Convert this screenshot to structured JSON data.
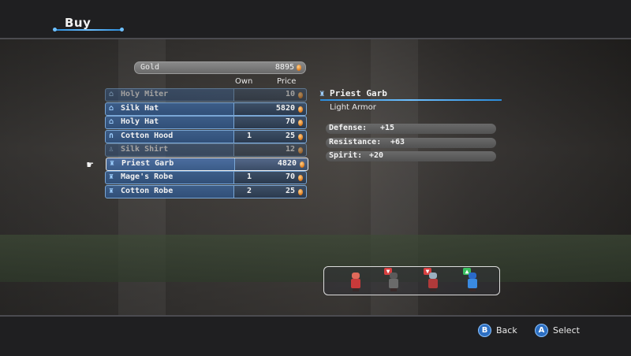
{
  "header": {
    "title": "Buy"
  },
  "gold": {
    "label": "Gold",
    "value": "8895"
  },
  "columns": {
    "own": "Own",
    "price": "Price"
  },
  "items": [
    {
      "name": "Holy Miter",
      "icon": "hat-icon",
      "own": "",
      "price": "10",
      "available": false
    },
    {
      "name": "Silk Hat",
      "icon": "hat-icon",
      "own": "",
      "price": "5820",
      "available": true
    },
    {
      "name": "Holy Hat",
      "icon": "hat-icon",
      "own": "",
      "price": "70",
      "available": true
    },
    {
      "name": "Cotton Hood",
      "icon": "hood-icon",
      "own": "1",
      "price": "25",
      "available": true
    },
    {
      "name": "Silk Shirt",
      "icon": "shirt-icon",
      "own": "",
      "price": "12",
      "available": false
    },
    {
      "name": "Priest Garb",
      "icon": "robe-icon",
      "own": "",
      "price": "4820",
      "available": true,
      "selected": true
    },
    {
      "name": "Mage's Robe",
      "icon": "robe-icon",
      "own": "1",
      "price": "70",
      "available": true
    },
    {
      "name": "Cotton Robe",
      "icon": "robe-icon",
      "own": "2",
      "price": "25",
      "available": true
    }
  ],
  "detail": {
    "title": "Priest Garb",
    "icon": "robe-icon",
    "subtitle": "Light Armor",
    "stats": [
      {
        "label": "Defense:",
        "value": "+15"
      },
      {
        "label": "Resistance:",
        "value": "+63"
      },
      {
        "label": "Spirit:",
        "value": "+20"
      }
    ]
  },
  "party": [
    {
      "name": "red-fighter",
      "head": "#e06a5a",
      "body": "#c83a3a",
      "badge": ""
    },
    {
      "name": "witch",
      "head": "#5a5a5a",
      "body": "#6a6a6a",
      "badge": "down",
      "badgeColor": "#d84040"
    },
    {
      "name": "knight",
      "head": "#9ab0c0",
      "body": "#b03a3a",
      "badge": "down",
      "badgeColor": "#d84040"
    },
    {
      "name": "mage",
      "head": "#2a6ac8",
      "body": "#3a8ae0",
      "badge": "up",
      "badgeColor": "#3ac060"
    }
  ],
  "footer": {
    "back_key": "B",
    "back_label": "Back",
    "select_key": "A",
    "select_label": "Select"
  }
}
